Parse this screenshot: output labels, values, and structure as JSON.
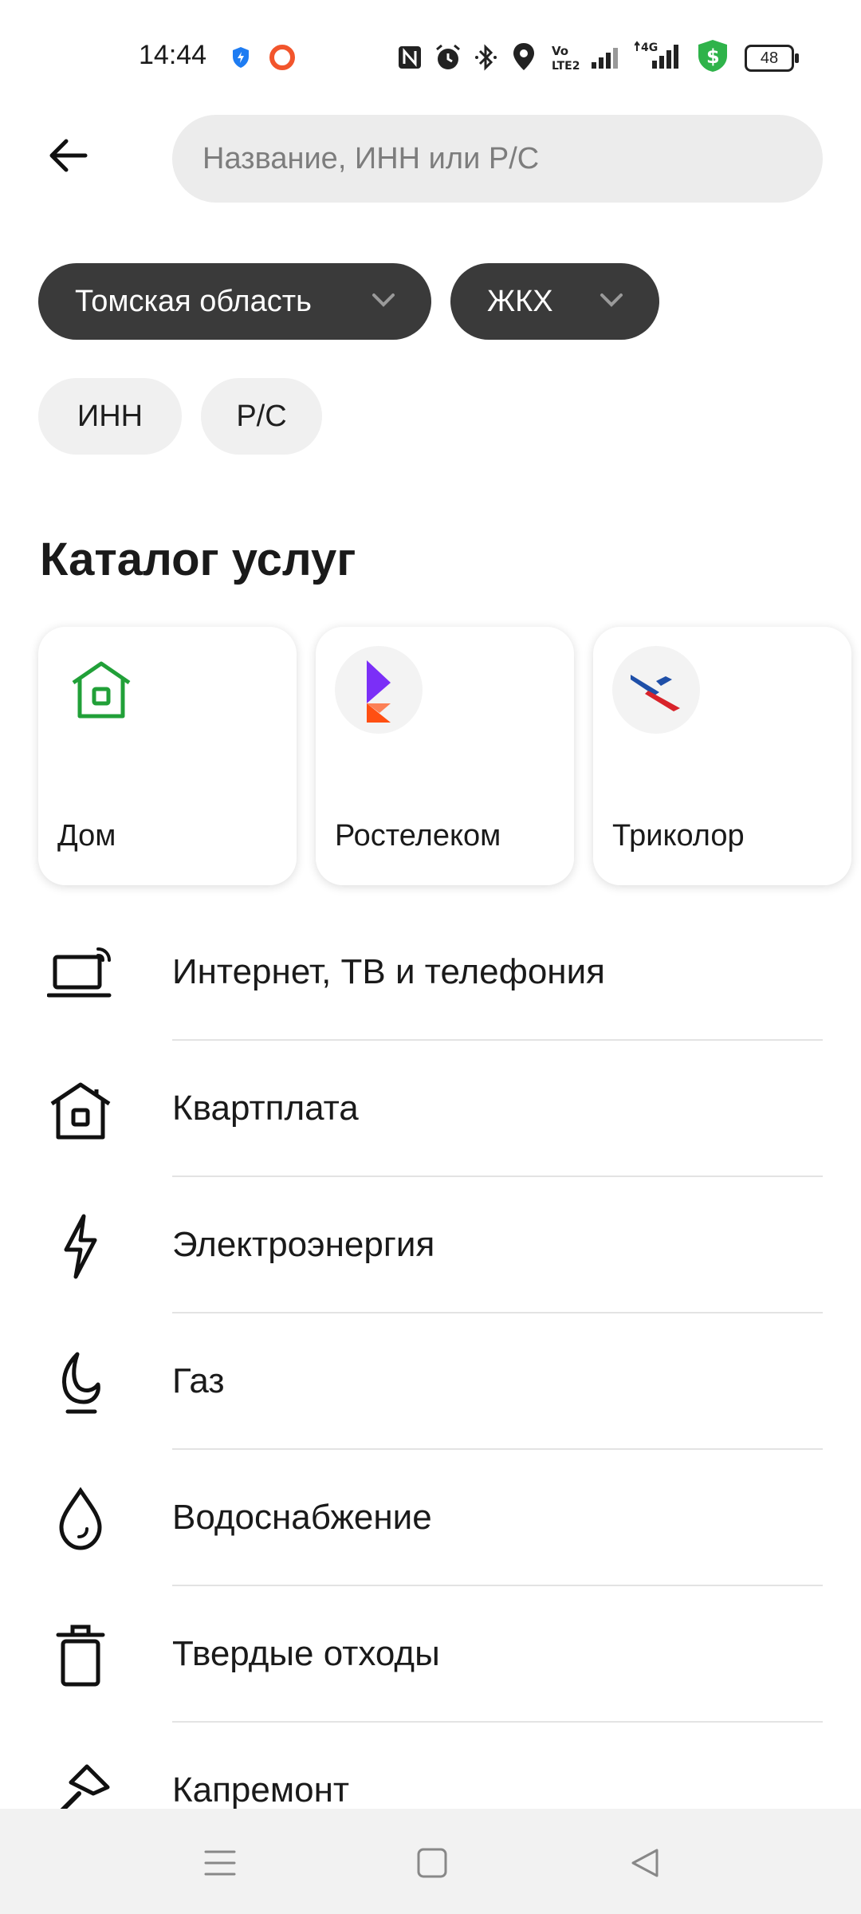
{
  "status_bar": {
    "time": "14:44",
    "battery": "48"
  },
  "search": {
    "placeholder": "Название, ИНН или Р/С"
  },
  "filters": {
    "region": "Томская область",
    "category": "ЖКХ",
    "inn": "ИНН",
    "rs": "Р/С"
  },
  "catalog": {
    "title": "Каталог услуг",
    "cards": [
      {
        "label": "Дом",
        "icon": "house-icon"
      },
      {
        "label": "Ростелеком",
        "icon": "rostelecom-logo"
      },
      {
        "label": "Триколор",
        "icon": "tricolor-logo"
      }
    ]
  },
  "categories": [
    {
      "label": "Интернет, ТВ и телефония",
      "icon": "laptop-wifi-icon"
    },
    {
      "label": "Квартплата",
      "icon": "house-icon"
    },
    {
      "label": "Электроэнергия",
      "icon": "lightning-icon"
    },
    {
      "label": "Газ",
      "icon": "flame-icon"
    },
    {
      "label": "Водоснабжение",
      "icon": "water-drop-icon"
    },
    {
      "label": "Твердые отходы",
      "icon": "trash-icon"
    },
    {
      "label": "Капремонт",
      "icon": "hammer-icon"
    }
  ],
  "colors": {
    "accent_green": "#21a038",
    "chip_dark": "#3a3a3a",
    "rostelecom_purple": "#7b2ff7",
    "rostelecom_orange": "#ff4f12"
  }
}
